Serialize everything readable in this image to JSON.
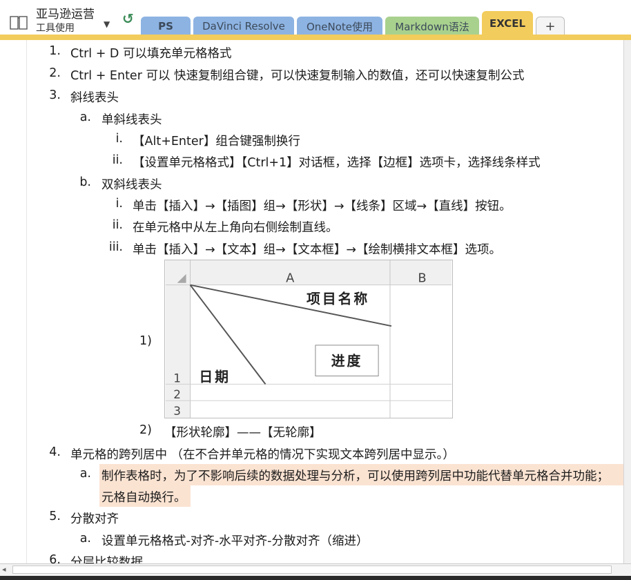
{
  "notebook": {
    "title": "亚马逊运营",
    "section": "工具使用",
    "icon": "notebook-icon",
    "caret_icon": "caret-down-icon",
    "back_icon": "back-arrow-icon"
  },
  "tabs": [
    {
      "label": "PS",
      "color": "#8db3e2",
      "active": false
    },
    {
      "label": "DaVinci Resolve",
      "color": "#8db3e2",
      "active": false
    },
    {
      "label": "OneNote使用",
      "color": "#8db3e2",
      "active": false
    },
    {
      "label": "Markdown语法",
      "color": "#a9d18e",
      "active": false
    },
    {
      "label": "EXCEL",
      "color": "#f2cc5c",
      "active": true
    },
    {
      "label": "+",
      "color": "#f4f4f4",
      "active": false
    }
  ],
  "content": {
    "items": [
      {
        "marker": "1.",
        "text": "Ctrl + D 可以填充单元格格式"
      },
      {
        "marker": "2.",
        "text": "Ctrl + Enter 可以 快速复制组合键，可以快速复制输入的数值，还可以快速复制公式"
      },
      {
        "marker": "3.",
        "text": "斜线表头"
      },
      {
        "marker": "a.",
        "text": "单斜线表头"
      },
      {
        "marker": "i.",
        "text": "【Alt+Enter】组合键强制换行"
      },
      {
        "marker": "ii.",
        "text": "【设置单元格格式】【Ctrl+1】对话框，选择【边框】选项卡，选择线条样式"
      },
      {
        "marker": "b.",
        "text": "双斜线表头"
      },
      {
        "marker": "i.",
        "text": "单击【插入】→【插图】组→【形状】→【线条】区域→【直线】按钮。"
      },
      {
        "marker": "ii.",
        "text": "在单元格中从左上角向右侧绘制直线。"
      },
      {
        "marker": "iii.",
        "text": "单击【插入】→【文本】组→【文本框】→【绘制横排文本框】选项。"
      },
      {
        "marker": "1)",
        "text": ""
      },
      {
        "marker": "2)",
        "text": "【形状轮廓】——【无轮廓】"
      },
      {
        "marker": "4.",
        "text": "单元格的跨列居中 （在不合并单元格的情况下实现文本跨列居中显示。）"
      },
      {
        "marker": "a.",
        "text": "制作表格时，为了不影响后续的数据处理与分析，可以使用跨列居中功能代替单元格合并功能；"
      },
      {
        "marker": "",
        "text": "元格自动换行。"
      },
      {
        "marker": "5.",
        "text": "分散对齐"
      },
      {
        "marker": "a.",
        "text": "设置单元格格式-对齐-水平对齐-分散对齐（缩进）"
      },
      {
        "marker": "6.",
        "text": "分层比较数据"
      }
    ],
    "highlight_color": "#fbe3d2"
  },
  "excel_figure": {
    "col_headers": [
      "A",
      "B"
    ],
    "row_numbers": [
      "1",
      "2",
      "3"
    ],
    "cell_labels": {
      "top_right": "项目名称",
      "middle": "进度",
      "bottom_left": "日期"
    }
  },
  "colors": {
    "accent": "#f2cc5c",
    "tab_blue": "#8db3e2",
    "tab_green": "#a9d18e"
  }
}
